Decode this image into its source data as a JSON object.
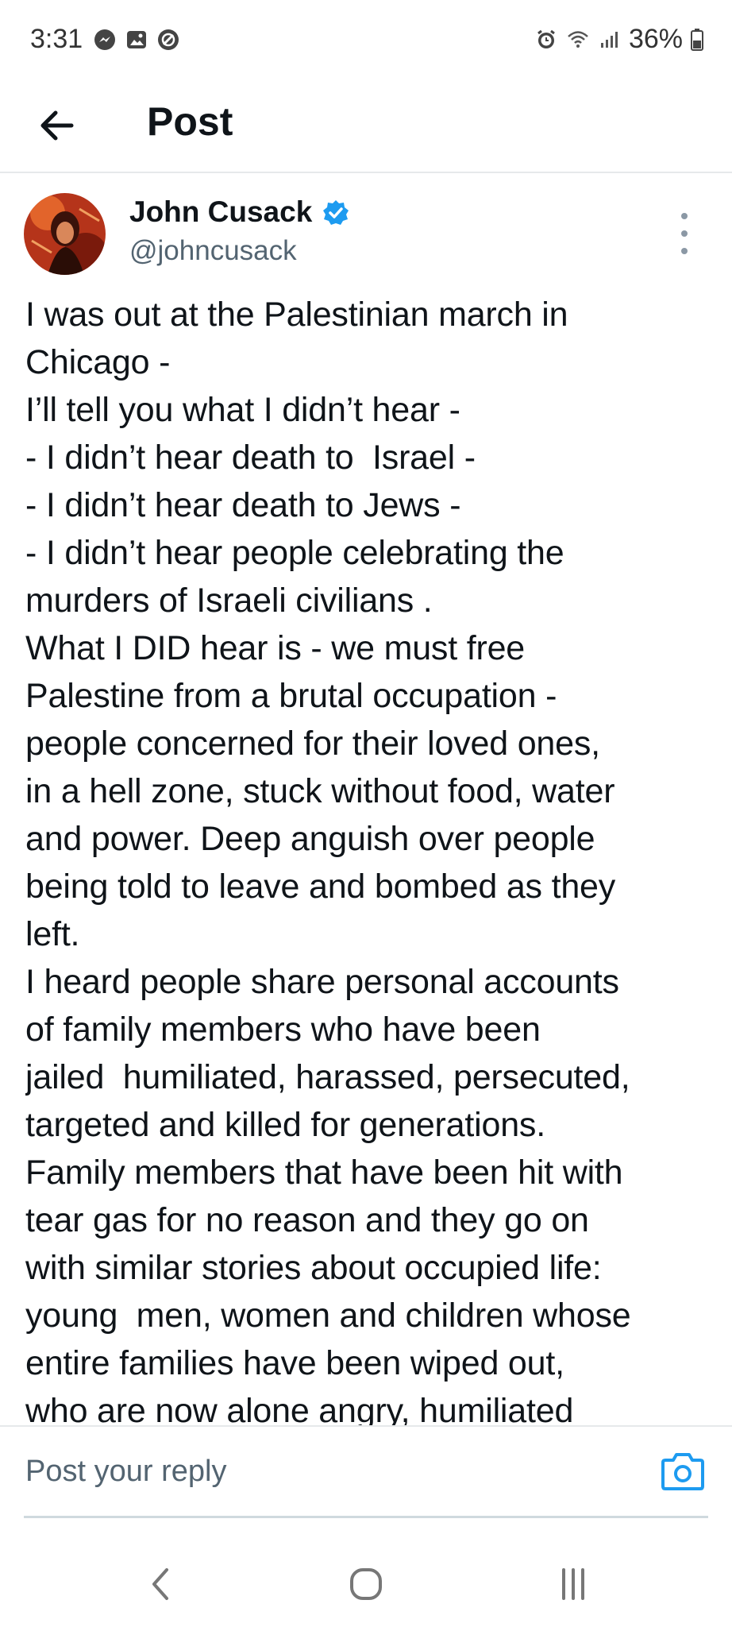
{
  "status_bar": {
    "time": "3:31",
    "left_icons": [
      "messenger-icon",
      "gallery-icon",
      "blocked-icon"
    ],
    "right_icons": [
      "alarm-icon",
      "wifi-icon",
      "signal-icon",
      "battery-icon"
    ],
    "battery": "36%"
  },
  "header": {
    "back_icon": "arrow-left-icon",
    "title": "Post"
  },
  "post": {
    "author_name": "John Cusack",
    "author_handle": "@johncusack",
    "verified": true,
    "lines": [
      "I was out at the Palestinian march in",
      "Chicago -",
      "I’ll tell you what I didn’t hear -",
      "- I didn’t hear death to  Israel -",
      "- I didn’t hear death to Jews -",
      "- I didn’t hear people celebrating the",
      "murders of Israeli civilians .",
      "What I DID hear is - we must free",
      "Palestine from a brutal occupation -",
      "people concerned for their loved ones,",
      "in a hell zone, stuck without food, water",
      "and power. Deep anguish over people",
      "being told to leave and bombed as they",
      "left.",
      "I heard people share personal accounts",
      "of family members who have been",
      "jailed  humiliated, harassed, persecuted,",
      "targeted and killed for generations.",
      "Family members that have been hit with",
      "tear gas for no reason and they go on",
      "with similar stories about occupied life:",
      "young  men, women and children whose",
      "entire families have been wiped out,",
      "who are now alone angry, humiliated"
    ]
  },
  "reply": {
    "placeholder": "Post your reply",
    "camera_icon": "camera-icon"
  },
  "nav_bar": {
    "icons": [
      "back-nav-icon",
      "home-nav-icon",
      "recents-nav-icon"
    ]
  },
  "colors": {
    "text": "#0f1419",
    "secondary": "#536471",
    "accent": "#1d9bf0",
    "divider": "#e6e9eb"
  }
}
